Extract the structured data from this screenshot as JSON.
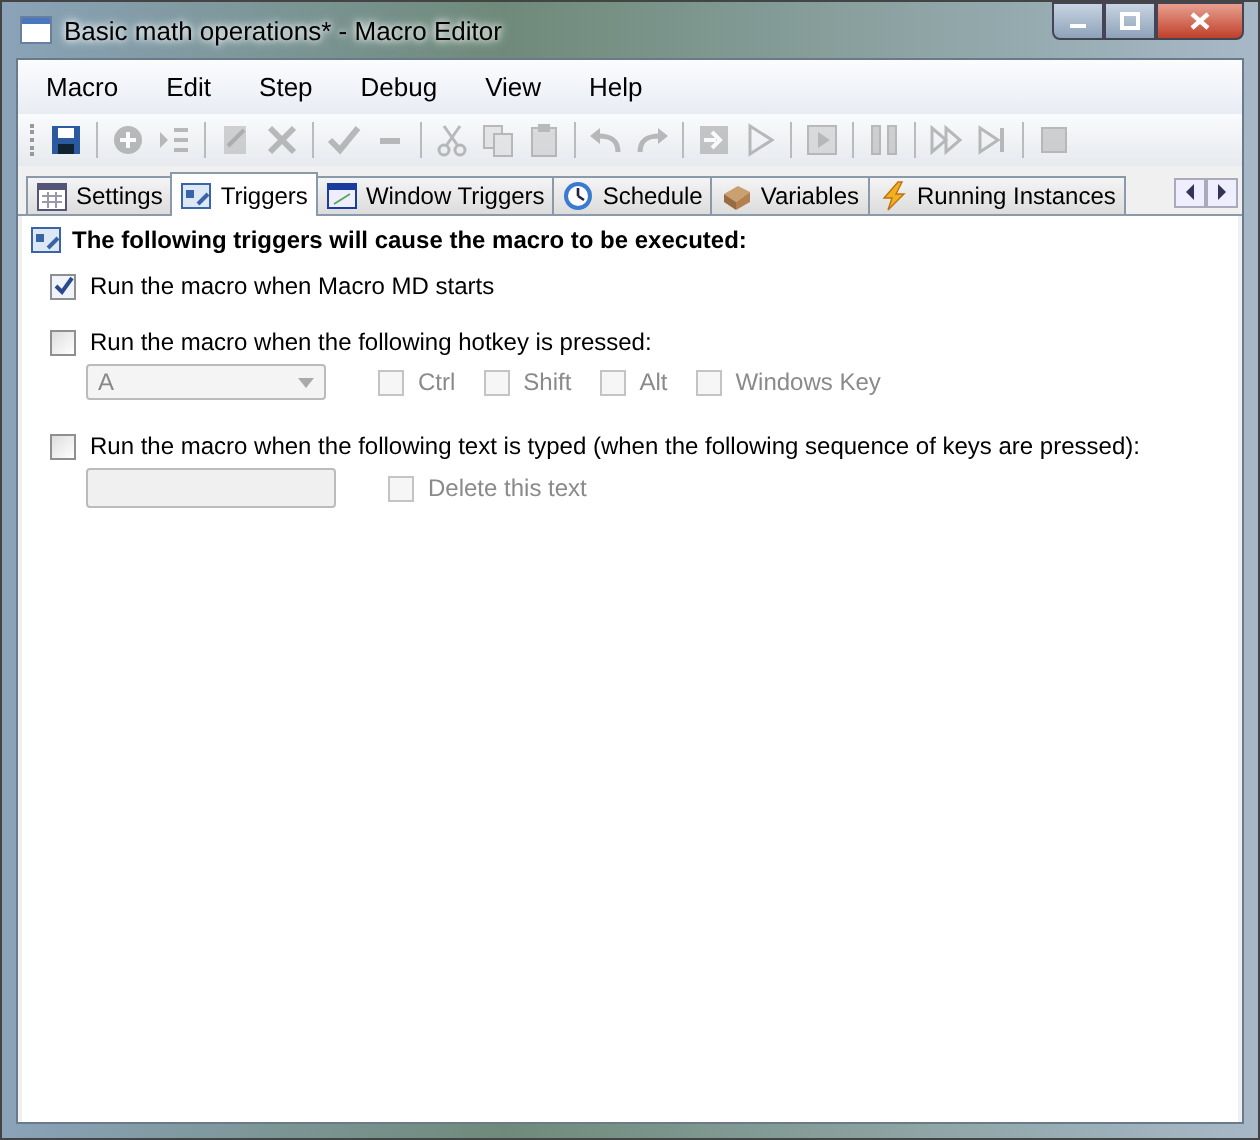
{
  "window": {
    "title": "Basic math operations* - Macro Editor"
  },
  "menu": [
    "Macro",
    "Edit",
    "Step",
    "Debug",
    "View",
    "Help"
  ],
  "toolbar": [
    [
      {
        "kind": "save",
        "disabled": false
      }
    ],
    [
      {
        "kind": "add",
        "disabled": true
      },
      {
        "kind": "insert",
        "disabled": true
      }
    ],
    [
      {
        "kind": "edit",
        "disabled": true
      },
      {
        "kind": "delete",
        "disabled": true
      }
    ],
    [
      {
        "kind": "check",
        "disabled": true
      },
      {
        "kind": "minus",
        "disabled": true
      }
    ],
    [
      {
        "kind": "cut",
        "disabled": true
      },
      {
        "kind": "copy",
        "disabled": true
      },
      {
        "kind": "paste",
        "disabled": true
      }
    ],
    [
      {
        "kind": "undo",
        "disabled": true
      },
      {
        "kind": "redo",
        "disabled": true
      }
    ],
    [
      {
        "kind": "run",
        "disabled": true
      },
      {
        "kind": "play",
        "disabled": true
      }
    ],
    [
      {
        "kind": "record",
        "disabled": true
      }
    ],
    [
      {
        "kind": "pause",
        "disabled": true
      }
    ],
    [
      {
        "kind": "forward",
        "disabled": true
      },
      {
        "kind": "skip",
        "disabled": true
      }
    ],
    [
      {
        "kind": "stop",
        "disabled": true
      }
    ]
  ],
  "tabs": [
    {
      "label": "Settings",
      "kind": "calendar",
      "selected": false
    },
    {
      "label": "Triggers",
      "kind": "triggers",
      "selected": true
    },
    {
      "label": "Window Triggers",
      "kind": "window",
      "selected": false
    },
    {
      "label": "Schedule",
      "kind": "clock",
      "selected": false
    },
    {
      "label": "Variables",
      "kind": "box",
      "selected": false
    },
    {
      "label": "Running Instances",
      "kind": "bolt",
      "selected": false
    }
  ],
  "heading": "The following triggers will cause the macro to be executed:",
  "triggers": [
    {
      "label": "Run the macro when Macro MD starts",
      "checked": true
    },
    {
      "label": "Run the macro when the following hotkey is pressed:",
      "checked": false
    },
    {
      "label": "Run the macro when the following text is typed (when the following sequence of keys are pressed):",
      "checked": false
    }
  ],
  "hotkey": {
    "key": "A",
    "disabled": true,
    "modifiers": [
      {
        "label": "Ctrl",
        "checked": false
      },
      {
        "label": "Shift",
        "checked": false
      },
      {
        "label": "Alt",
        "checked": false
      },
      {
        "label": "Windows Key",
        "checked": false
      }
    ]
  },
  "text_trigger": {
    "disabled": true,
    "delete": {
      "label": "Delete this text",
      "checked": false
    }
  }
}
